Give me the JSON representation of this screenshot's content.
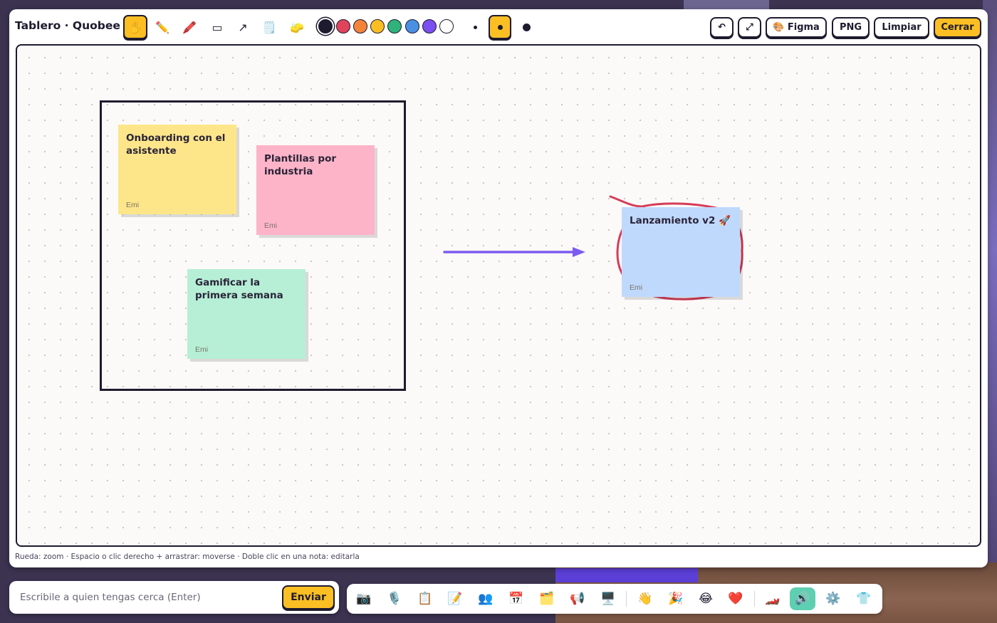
{
  "header": {
    "title": "Tablero · Quobee"
  },
  "tools": [
    {
      "name": "hand-icon",
      "glyph": "✋",
      "active": true
    },
    {
      "name": "pencil-icon",
      "glyph": "✏️",
      "active": false
    },
    {
      "name": "marker-icon",
      "glyph": "🖍️",
      "active": false
    },
    {
      "name": "rectangle-icon",
      "glyph": "▭",
      "active": false
    },
    {
      "name": "arrow-icon",
      "glyph": "↗",
      "active": false
    },
    {
      "name": "sticky-note-icon",
      "glyph": "🗒️",
      "active": false
    },
    {
      "name": "eraser-icon",
      "glyph": "🧽",
      "active": false
    }
  ],
  "colors": [
    "#1f1b2e",
    "#e0435c",
    "#f5843b",
    "#fbbf24",
    "#2fb37a",
    "#4a90e2",
    "#7c4ff0",
    "#ffffff"
  ],
  "selected_color": "#1f1b2e",
  "stroke_sizes": [
    "small",
    "medium",
    "large"
  ],
  "selected_size": "medium",
  "actions": {
    "undo_glyph": "↶",
    "fit_glyph": "⤢",
    "figma_label": "🎨 Figma",
    "png_label": "PNG",
    "clear_label": "Limpiar",
    "close_label": "Cerrar"
  },
  "notes": [
    {
      "text": "Onboarding con el asistente",
      "author": "Emi",
      "color": "#fde68a"
    },
    {
      "text": "Plantillas por industria",
      "author": "Emi",
      "color": "#fdb4c8"
    },
    {
      "text": "Gamificar la primera semana",
      "author": "Emi",
      "color": "#b6efd6"
    },
    {
      "text": "Lanzamiento v2 🚀",
      "author": "Emi",
      "color": "#bfd9fd"
    }
  ],
  "drawing_colors": {
    "arrow": "#7c5cf0",
    "circle": "#d63c5a",
    "frame": "#1f1b2e"
  },
  "hint": "Rueda: zoom · Espacio o clic derecho + arrastrar: moverse · Doble clic en una nota: editarla",
  "chat": {
    "placeholder": "Escribile a quien tengas cerca (Enter)",
    "send_label": "Enviar"
  },
  "dock": [
    {
      "name": "camera-icon",
      "glyph": "📷"
    },
    {
      "name": "microphone-icon",
      "glyph": "🎙️"
    },
    {
      "name": "clipboard-icon",
      "glyph": "📋"
    },
    {
      "name": "memo-icon",
      "glyph": "📝"
    },
    {
      "name": "people-icon",
      "glyph": "👥"
    },
    {
      "name": "calendar-icon",
      "glyph": "📅"
    },
    {
      "name": "folders-icon",
      "glyph": "🗂️"
    },
    {
      "name": "megaphone-icon",
      "glyph": "📢"
    },
    {
      "name": "screen-icon",
      "glyph": "🖥️"
    },
    {
      "name": "wave-icon",
      "glyph": "👋"
    },
    {
      "name": "party-icon",
      "glyph": "🎉"
    },
    {
      "name": "laugh-icon",
      "glyph": "😂"
    },
    {
      "name": "heart-icon",
      "glyph": "❤️"
    },
    {
      "name": "race-car-icon",
      "glyph": "🏎️"
    },
    {
      "name": "speaker-icon",
      "glyph": "🔊"
    },
    {
      "name": "settings-icon",
      "glyph": "⚙️"
    },
    {
      "name": "shirt-icon",
      "glyph": "👕"
    }
  ]
}
